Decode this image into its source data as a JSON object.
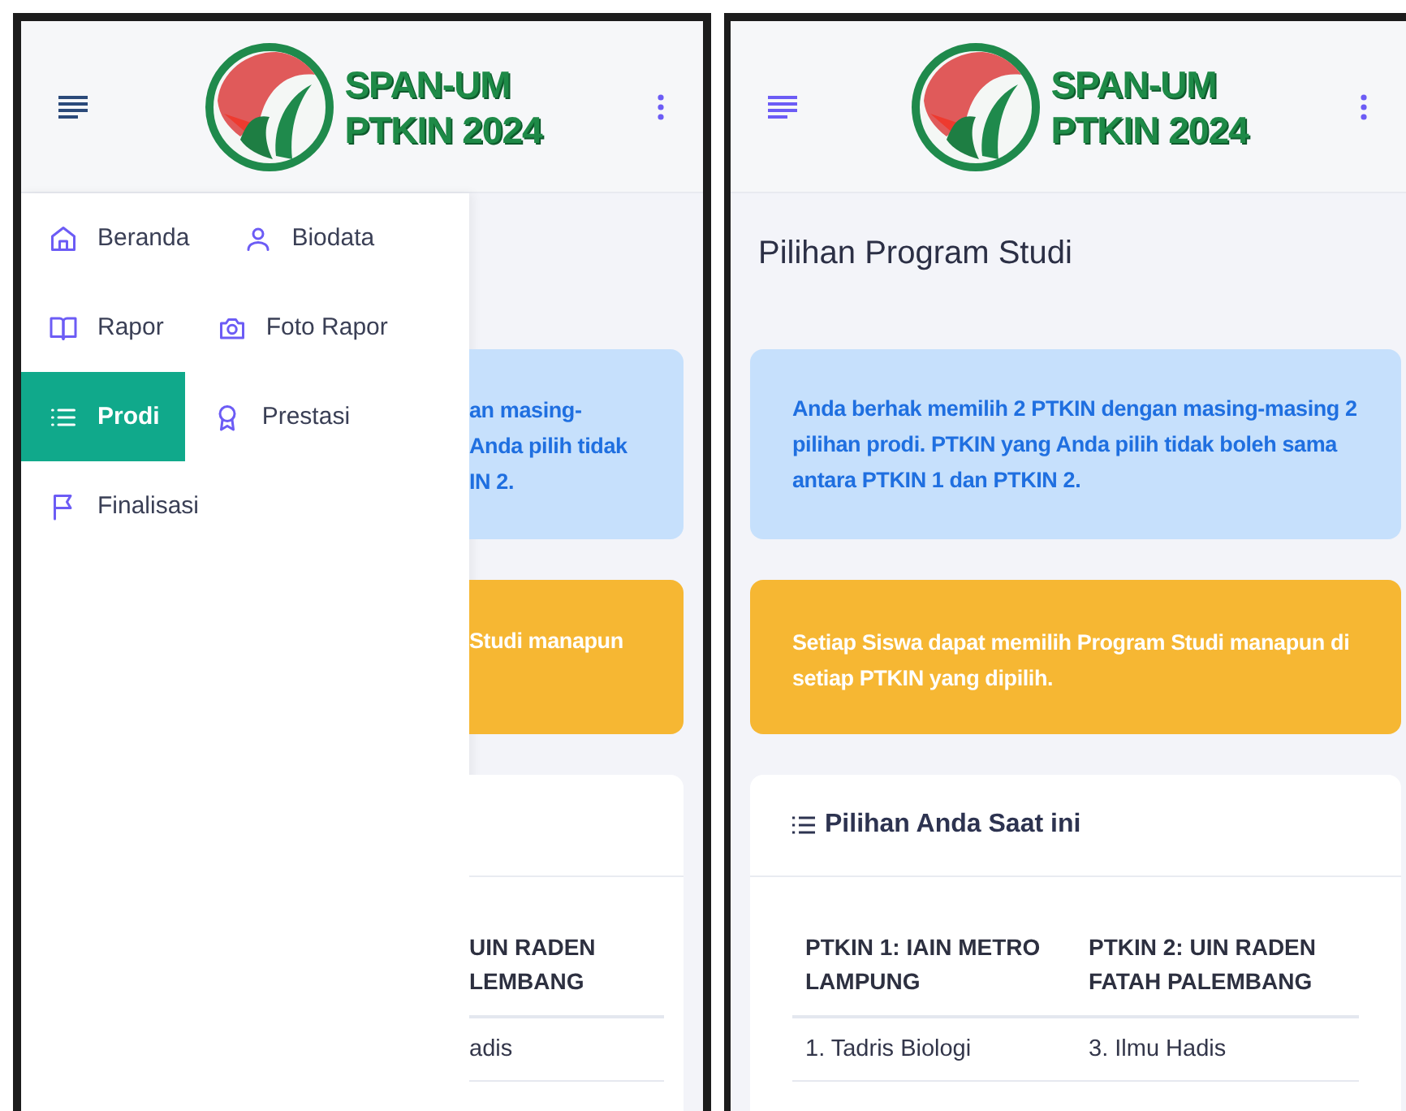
{
  "left_screen": {
    "header": {
      "logo_lines": [
        "SPAN-UM",
        "PTKIN 2024"
      ]
    },
    "menu": [
      {
        "label": "Beranda",
        "kind": "home",
        "selected": false
      },
      {
        "label": "Biodata",
        "kind": "user",
        "selected": false
      },
      {
        "label": "Rapor",
        "kind": "book",
        "selected": false
      },
      {
        "label": "Foto Rapor",
        "kind": "camera",
        "selected": false
      },
      {
        "label": "Prodi",
        "kind": "list",
        "selected": true
      },
      {
        "label": "Prestasi",
        "kind": "award",
        "selected": false
      },
      {
        "label": "Finalisasi",
        "kind": "flag",
        "selected": false
      }
    ],
    "visible_content": {
      "info_card_lines": [
        "an masing-",
        "Anda pilih tidak",
        "IN 2."
      ],
      "notice_card_lines": [
        "Studi manapun"
      ],
      "table_header_lines": [
        "UIN RADEN",
        "LEMBANG"
      ],
      "table_cells": [
        "adis"
      ]
    }
  },
  "right_screen": {
    "header": {
      "logo_lines": [
        "SPAN-UM",
        "PTKIN 2024"
      ]
    },
    "page_title": "Pilihan Program Studi",
    "info_card": "Anda berhak memilih 2 PTKIN dengan masing-masing 2 pilihan prodi. PTKIN yang Anda pilih tidak boleh sama antara PTKIN 1 dan PTKIN 2.",
    "notice_card": "Setiap Siswa dapat memilih Program Studi manapun di setiap PTKIN yang dipilih.",
    "selection_card": {
      "title": "Pilihan Anda Saat ini",
      "columns": [
        "PTKIN 1: IAIN METRO LAMPUNG",
        "PTKIN 2: UIN RADEN FATAH PALEMBANG"
      ],
      "rows": [
        [
          "1. Tadris Biologi",
          "3. Ilmu Hadis"
        ]
      ]
    }
  }
}
